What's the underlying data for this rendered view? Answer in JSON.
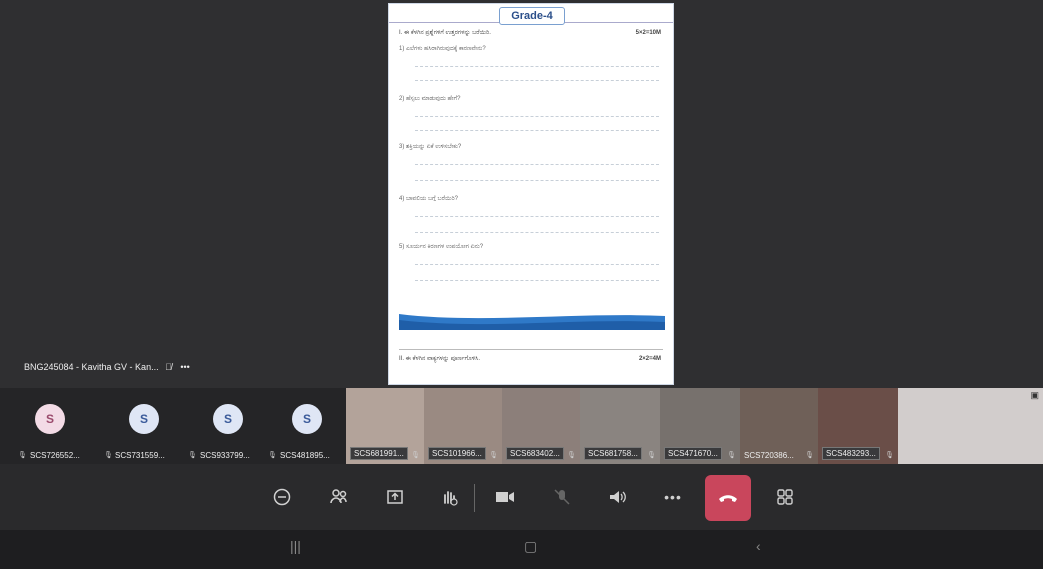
{
  "document": {
    "grade_title": "Grade-4",
    "section1_heading": "I.  ಈ ಕೆಳಗಿನ ಪ್ರಶ್ನೆಗಳಿಗೆ ಉತ್ತರಗಳನ್ನು ಬರೆಯಿರಿ.",
    "section1_marks": "5×2=10M",
    "questions": [
      "1)  ಎಲೆಗಳು ಹಸಿರಾಗಿರುವುದಕ್ಕೆ ಕಾರಣವೇನು?",
      "2)  ಹೆಸ್ಸಲು ಮಾಡುವುದು ಹೇಗೆ?",
      "3)  ಶಕ್ತಿಯನ್ನು ಏಕೆ ಉಳಿಸಬೇಕು?",
      "4)  ಬಾವಲಿಯ ಬಗ್ಗೆ ಬರೆಯಿರಿ?",
      "5)  ಸೂರ್ಯನ ಕಿರಣಗಳ ಉಪಯೋಗ ಏನು?"
    ],
    "section2_heading": "II.  ಈ ಕೆಳಗಿನ ವಾಕ್ಯಗಳನ್ನು ಪೂರ್ಣಗೊಳಿಸಿ.",
    "section2_marks": "2×2=4M"
  },
  "presenter": {
    "name": "BNG245084 - Kavitha GV - Kan...",
    "more": "•••"
  },
  "participants": [
    {
      "label": "SCS726552...",
      "initial": "S",
      "type": "avatar",
      "bg": "#f3dbe6",
      "fg": "#9a4a6c"
    },
    {
      "label": "SCS731559...",
      "initial": "S",
      "type": "avatar",
      "bg": "#dfe6f5",
      "fg": "#3a5a9a"
    },
    {
      "label": "SCS933799...",
      "initial": "S",
      "type": "avatar",
      "bg": "#dfe6f5",
      "fg": "#3a5a9a"
    },
    {
      "label": "SCS481895...",
      "initial": "S",
      "type": "avatar",
      "bg": "#dfe6f5",
      "fg": "#3a5a9a"
    },
    {
      "label": "SCS681991...",
      "type": "video",
      "bg": "#b3a39a"
    },
    {
      "label": "SCS101966...",
      "type": "video",
      "bg": "#9a8a82"
    },
    {
      "label": "SCS683402...",
      "type": "video",
      "bg": "#8c7f7a"
    },
    {
      "label": "SCS681758...",
      "type": "video",
      "bg": "#8a8480"
    },
    {
      "label": "SCS471670...",
      "type": "video",
      "bg": "#77716d"
    },
    {
      "label": "SCS720386...",
      "type": "video",
      "bg": "#6f6058"
    },
    {
      "label": "SCS483293...",
      "type": "video",
      "bg": "#6a4e48"
    },
    {
      "label": "",
      "type": "video",
      "bg": "#d2cdcc"
    }
  ],
  "colors": {
    "end_call": "#c9465c",
    "accent": "#2b4f8a",
    "wave": "#2f79c8"
  }
}
